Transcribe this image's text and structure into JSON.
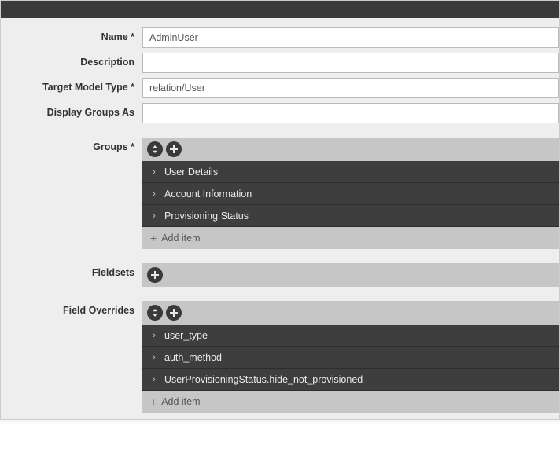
{
  "labels": {
    "name": "Name *",
    "description": "Description",
    "targetModelType": "Target Model Type *",
    "displayGroupsAs": "Display Groups As",
    "groups": "Groups *",
    "fieldsets": "Fieldsets",
    "fieldOverrides": "Field Overrides"
  },
  "values": {
    "name": "AdminUser",
    "description": "",
    "targetModelType": "relation/User",
    "displayGroupsAs": ""
  },
  "groups": {
    "items": [
      {
        "label": "User Details"
      },
      {
        "label": "Account Information"
      },
      {
        "label": "Provisioning Status"
      }
    ],
    "addLabel": "Add item"
  },
  "fieldsets": {
    "items": []
  },
  "fieldOverrides": {
    "items": [
      {
        "label": "user_type"
      },
      {
        "label": "auth_method"
      },
      {
        "label": "UserProvisioningStatus.hide_not_provisioned"
      }
    ],
    "addLabel": "Add item"
  },
  "colors": {
    "darkBar": "#3a3a3a",
    "itemRow": "#3e3e3e",
    "greyBar": "#c6c6c6",
    "panelBg": "#eeeeee"
  }
}
